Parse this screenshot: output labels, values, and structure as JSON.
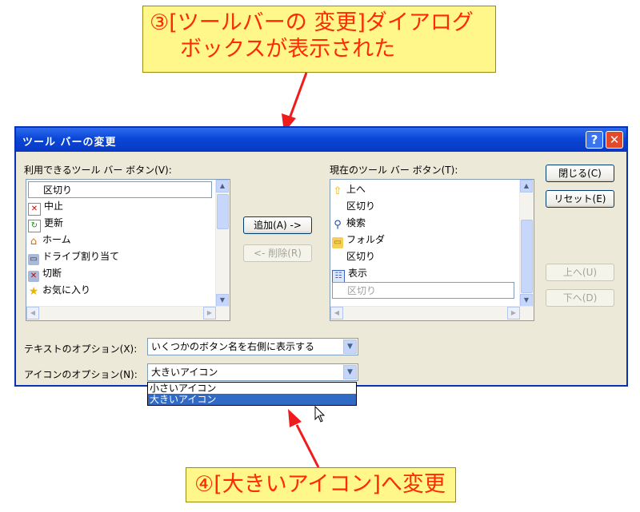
{
  "callouts": {
    "top_line1": "③[ツールバーの 変更]ダイアログ",
    "top_line2": "ボックスが表示された",
    "bottom": "④[大きいアイコン]へ変更"
  },
  "dialog": {
    "title": "ツール バーの変更",
    "help_label": "?",
    "close_label": "✕",
    "available_label": "利用できるツール バー ボタン(V):",
    "current_label": "現在のツール バー ボタン(T):",
    "available_items": [
      {
        "label": "区切り",
        "icon": "none"
      },
      {
        "label": "中止",
        "icon": "stop-icon"
      },
      {
        "label": "更新",
        "icon": "refresh-icon"
      },
      {
        "label": "ホーム",
        "icon": "home-icon"
      },
      {
        "label": "ドライブ割り当て",
        "icon": "map-drive-icon"
      },
      {
        "label": "切断",
        "icon": "disconnect-icon"
      },
      {
        "label": "お気に入り",
        "icon": "favorites-icon"
      }
    ],
    "current_items": [
      {
        "label": "上へ",
        "icon": "up-folder-icon"
      },
      {
        "label": "区切り",
        "icon": "none"
      },
      {
        "label": "検索",
        "icon": "search-icon"
      },
      {
        "label": "フォルダ",
        "icon": "folder-icon"
      },
      {
        "label": "区切り",
        "icon": "none"
      },
      {
        "label": "表示",
        "icon": "views-icon"
      },
      {
        "label": "区切り",
        "icon": "none"
      }
    ],
    "buttons": {
      "add": "追加(A) ->",
      "remove": "<- 削除(R)",
      "close": "閉じる(C)",
      "reset": "リセット(E)",
      "move_up": "上へ(U)",
      "move_down": "下へ(D)"
    },
    "text_options_label": "テキストのオプション(X):",
    "text_options_value": "いくつかのボタン名を右側に表示する",
    "icon_options_label": "アイコンのオプション(N):",
    "icon_options_value": "大きいアイコン",
    "icon_options_dropdown": [
      "小さいアイコン",
      "大きいアイコン"
    ]
  },
  "colors": {
    "callout_bg": "#fff78a",
    "callout_text": "#ff2a00",
    "arrow": "#ee1c1c",
    "title_bar": "#0a47d6",
    "highlight": "#316ac5"
  }
}
